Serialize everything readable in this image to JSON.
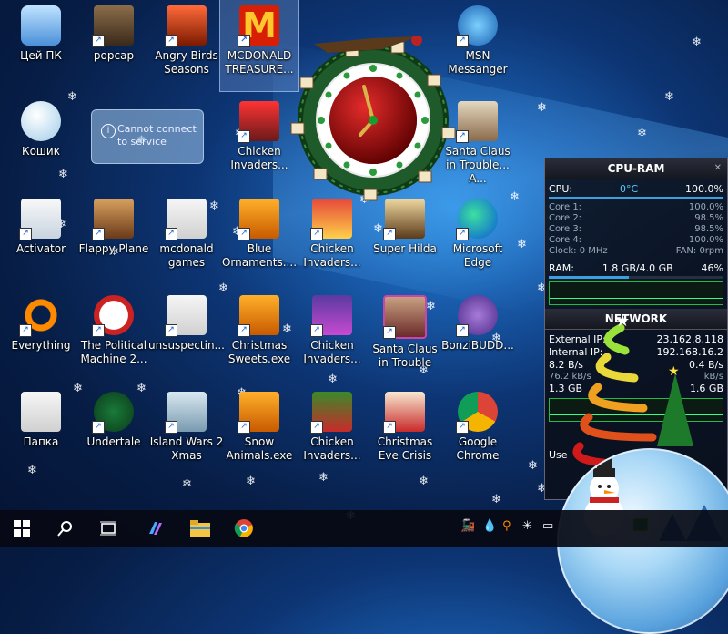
{
  "desktop": {
    "icons": [
      {
        "label": "Цей ПК"
      },
      {
        "label": "popcap"
      },
      {
        "label": "Angry Birds Seasons"
      },
      {
        "label": "MCDONALD TREASURE..."
      },
      {
        "label": "MSN Messanger"
      },
      {
        "label": "Кошик"
      },
      {
        "label": "Chicken Invaders..."
      },
      {
        "label": "Santa Claus in Trouble... A..."
      },
      {
        "label": "Activator"
      },
      {
        "label": "Flappy Plane"
      },
      {
        "label": "mcdonald games"
      },
      {
        "label": "Blue Ornaments...."
      },
      {
        "label": "Chicken Invaders..."
      },
      {
        "label": "Super Hilda"
      },
      {
        "label": "Microsoft Edge"
      },
      {
        "label": "Everything"
      },
      {
        "label": "The Political Machine 2..."
      },
      {
        "label": "unsuspectin..."
      },
      {
        "label": "Christmas Sweets.exe"
      },
      {
        "label": "Chicken Invaders..."
      },
      {
        "label": "Santa Claus in Trouble"
      },
      {
        "label": "BonziBUDD..."
      },
      {
        "label": "Папка"
      },
      {
        "label": "Undertale"
      },
      {
        "label": "Island Wars 2 Xmas"
      },
      {
        "label": "Snow Animals.exe"
      },
      {
        "label": "Chicken Invaders..."
      },
      {
        "label": "Christmas Eve Crisis"
      },
      {
        "label": "Google Chrome"
      }
    ]
  },
  "notification": {
    "text": "Cannot connect to service",
    "icon": "info-icon"
  },
  "cpu_ram_gadget": {
    "title": "CPU-RAM",
    "cpu_label": "CPU:",
    "cpu_temp": "0°C",
    "cpu_value": "100.0%",
    "cores": [
      {
        "label": "Core 1:",
        "value": "100.0%"
      },
      {
        "label": "Core 2:",
        "value": "98.5%"
      },
      {
        "label": "Core 3:",
        "value": "98.5%"
      },
      {
        "label": "Core 4:",
        "value": "100.0%"
      }
    ],
    "clock": "Clock: 0 MHz",
    "fan": "FAN: 0rpm",
    "ram_label": "RAM:",
    "ram_value": "1.8 GB/4.0 GB",
    "ram_percent": "46%",
    "ram_fraction": 0.46,
    "cpu_fraction": 1.0
  },
  "network_gadget": {
    "title": "NETWORK",
    "external_label": "External IP:",
    "external_value": "23.162.8.118",
    "internal_label": "Internal IP:",
    "internal_value": "192.168.16.2",
    "rate1_left": "8.2 B/s",
    "rate1_right": "0.4 B/s",
    "rate2_left": "76.2 kB/s",
    "rate2_right": "kB/s",
    "total_left": "1.3 GB",
    "total_right": "1.6 GB",
    "use_label": "Use"
  },
  "taskbar": {
    "start_icon": "windows-icon",
    "search_icon": "search-icon",
    "taskview_icon": "task-view-icon",
    "copilot_icon": "copilot-icon",
    "explorer_icon": "folder-icon",
    "chrome_icon": "chrome-icon"
  },
  "colors": {
    "desktop_bg": "#0d3574",
    "accent": "#1a5fb0",
    "mcdonalds_red": "#d81e05",
    "mcdonalds_yellow": "#ffc72c"
  }
}
